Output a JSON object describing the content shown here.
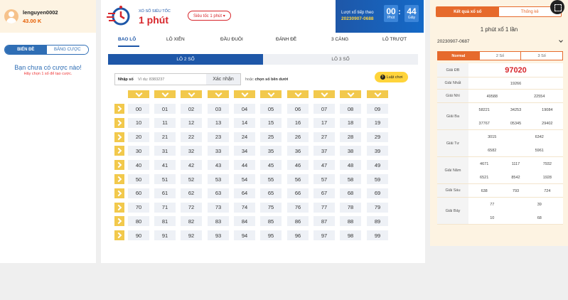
{
  "left": {
    "user_name": "lenguyen0002",
    "balance": "43.00 K",
    "seg_active": "BIẾN ĐỀ",
    "seg_other": "BẢNG CƯỢC",
    "no_bet": "Bạn chưa có cược nào!",
    "no_bet_sub": "Hãy chọn 1 số để tạo cược."
  },
  "header": {
    "logo_top": "XỔ SỐ SIÊU TỐC",
    "logo_title": "1 phút",
    "speed_select": "Siêu tốc 1 phút ▾",
    "turn_label": "Lượt xổ tiếp theo",
    "turn_id": "20230907-0688",
    "minutes": "00",
    "minutes_cap": "Phút",
    "seconds": "44",
    "seconds_cap": "Giây",
    "colon": ":"
  },
  "tabs": [
    "BAO LÔ",
    "LÔ XIÊN",
    "ĐẦU ĐUÔI",
    "ĐÁNH ĐỀ",
    "3 CÀNG",
    "LÔ TRƯỢT"
  ],
  "subtabs": [
    "LÔ 2 SỐ",
    "LÔ 3 SỐ"
  ],
  "input": {
    "label": "Nhập số",
    "placeholder": "Ví dụ: 8383237",
    "confirm": "Xác nhận",
    "hint_prefix": "hoặc",
    "hint_bold": "chọn số bên dưới",
    "rules": "Luật chơi"
  },
  "grid": {
    "rows": [
      [
        "00",
        "01",
        "02",
        "03",
        "04",
        "05",
        "06",
        "07",
        "08",
        "09"
      ],
      [
        "10",
        "11",
        "12",
        "13",
        "14",
        "15",
        "16",
        "17",
        "18",
        "19"
      ],
      [
        "20",
        "21",
        "22",
        "23",
        "24",
        "25",
        "26",
        "27",
        "28",
        "29"
      ],
      [
        "30",
        "31",
        "32",
        "33",
        "34",
        "35",
        "36",
        "37",
        "38",
        "39"
      ],
      [
        "40",
        "41",
        "42",
        "43",
        "44",
        "45",
        "46",
        "47",
        "48",
        "49"
      ],
      [
        "50",
        "51",
        "52",
        "53",
        "54",
        "55",
        "56",
        "57",
        "58",
        "59"
      ],
      [
        "60",
        "61",
        "62",
        "63",
        "64",
        "65",
        "66",
        "67",
        "68",
        "69"
      ],
      [
        "70",
        "71",
        "72",
        "73",
        "74",
        "75",
        "76",
        "77",
        "78",
        "79"
      ],
      [
        "80",
        "81",
        "82",
        "83",
        "84",
        "85",
        "86",
        "87",
        "88",
        "89"
      ],
      [
        "90",
        "91",
        "92",
        "93",
        "94",
        "95",
        "96",
        "97",
        "98",
        "99"
      ]
    ]
  },
  "right": {
    "tab_active": "Kết quả xổ số",
    "tab_other": "Thống kê",
    "subtitle": "1 phút xổ 1 lần",
    "draw_select": "20230907-0687",
    "mode_tabs": [
      "Normal",
      "2 Số",
      "3 Số"
    ],
    "results": [
      {
        "label": "Giải ĐB",
        "values": [
          "97020"
        ],
        "big": true
      },
      {
        "label": "Giải Nhất",
        "values": [
          "19266"
        ]
      },
      {
        "label": "Giải Nhì",
        "values": [
          "49588",
          "22554"
        ]
      },
      {
        "label": "Giải Ba",
        "values": [
          "58221",
          "34253",
          "19084",
          "37767",
          "05345",
          "29402"
        ]
      },
      {
        "label": "Giải Tư",
        "values": [
          "3015",
          "6342",
          "6582",
          "5961"
        ]
      },
      {
        "label": "Giải Năm",
        "values": [
          "4671",
          "1117",
          "7932",
          "6521",
          "8542",
          "1928"
        ]
      },
      {
        "label": "Giải Sáu",
        "values": [
          "638",
          "793",
          "724"
        ]
      },
      {
        "label": "Giải Bảy",
        "values": [
          "77",
          "39",
          "10",
          "68"
        ]
      }
    ]
  },
  "colors": {
    "brand_blue": "#1e57a8",
    "accent_orange": "#e66a2c",
    "highlight_yellow": "#f2c94c",
    "red": "#d7262b"
  }
}
